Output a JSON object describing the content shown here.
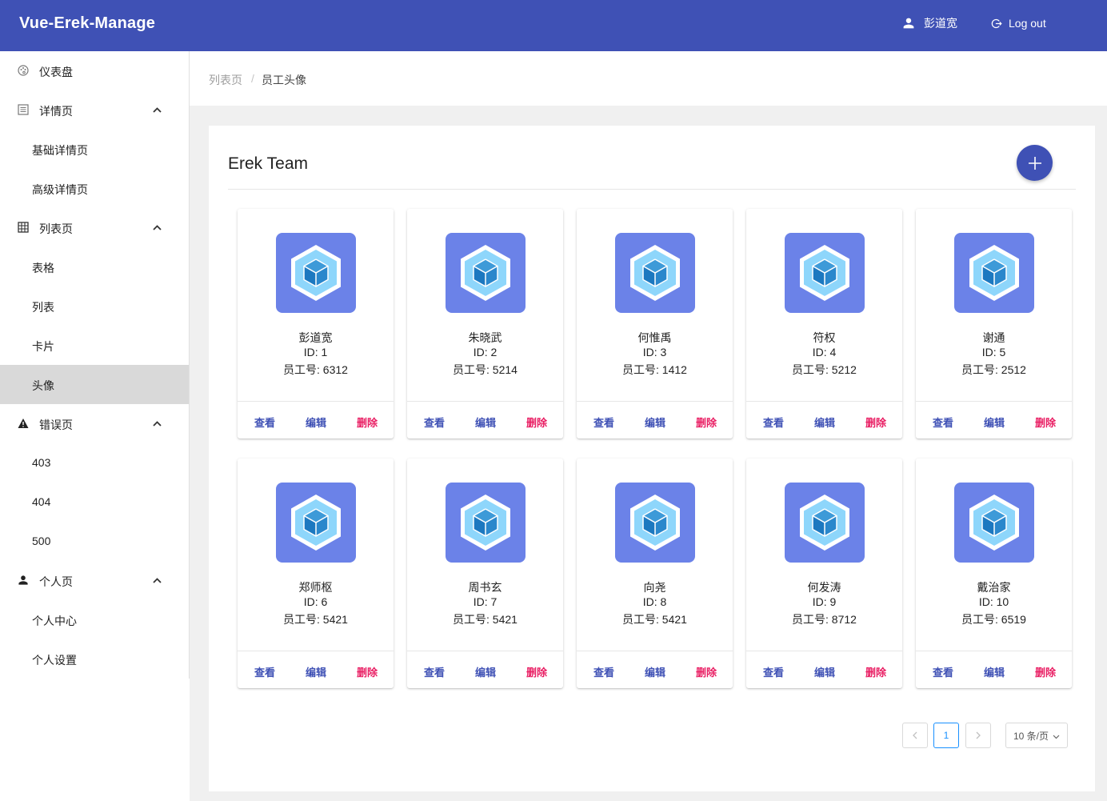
{
  "header": {
    "brand": "Vue-Erek-Manage",
    "user_name": "彭道宽",
    "logout_label": "Log out"
  },
  "sidebar": {
    "items": [
      {
        "label": "仪表盘",
        "icon": "palette-icon",
        "level": 1
      },
      {
        "label": "详情页",
        "icon": "list-alt-icon",
        "level": 1,
        "expanded": true
      },
      {
        "label": "基础详情页",
        "level": 2
      },
      {
        "label": "高级详情页",
        "level": 2
      },
      {
        "label": "列表页",
        "icon": "grid-icon",
        "level": 1,
        "expanded": true
      },
      {
        "label": "表格",
        "level": 2
      },
      {
        "label": "列表",
        "level": 2
      },
      {
        "label": "卡片",
        "level": 2
      },
      {
        "label": "头像",
        "level": 2,
        "active": true
      },
      {
        "label": "错误页",
        "icon": "warning-icon",
        "level": 1,
        "expanded": true
      },
      {
        "label": "403",
        "level": 2
      },
      {
        "label": "404",
        "level": 2
      },
      {
        "label": "500",
        "level": 2
      },
      {
        "label": "个人页",
        "icon": "person-icon",
        "level": 1,
        "expanded": true
      },
      {
        "label": "个人中心",
        "level": 2
      },
      {
        "label": "个人设置",
        "level": 2
      }
    ]
  },
  "breadcrumb": {
    "parent": "列表页",
    "separator": "/",
    "current": "员工头像"
  },
  "panel": {
    "title": "Erek Team",
    "add_button_icon": "plus-icon"
  },
  "cards": [
    {
      "name": "彭道宽",
      "id": "ID: 1",
      "employee_no": "员工号: 6312",
      "view": "查看",
      "edit": "编辑",
      "delete": "删除"
    },
    {
      "name": "朱晓武",
      "id": "ID: 2",
      "employee_no": "员工号: 5214",
      "view": "查看",
      "edit": "编辑",
      "delete": "删除"
    },
    {
      "name": "何惟禹",
      "id": "ID: 3",
      "employee_no": "员工号: 1412",
      "view": "查看",
      "edit": "编辑",
      "delete": "删除"
    },
    {
      "name": "符权",
      "id": "ID: 4",
      "employee_no": "员工号: 5212",
      "view": "查看",
      "edit": "编辑",
      "delete": "删除"
    },
    {
      "name": "谢通",
      "id": "ID: 5",
      "employee_no": "员工号: 2512",
      "view": "查看",
      "edit": "编辑",
      "delete": "删除"
    },
    {
      "name": "郑师枢",
      "id": "ID: 6",
      "employee_no": "员工号: 5421",
      "view": "查看",
      "edit": "编辑",
      "delete": "删除"
    },
    {
      "name": "周书玄",
      "id": "ID: 7",
      "employee_no": "员工号: 5421",
      "view": "查看",
      "edit": "编辑",
      "delete": "删除"
    },
    {
      "name": "向尧",
      "id": "ID: 8",
      "employee_no": "员工号: 5421",
      "view": "查看",
      "edit": "编辑",
      "delete": "删除"
    },
    {
      "name": "何发涛",
      "id": "ID: 9",
      "employee_no": "员工号: 8712",
      "view": "查看",
      "edit": "编辑",
      "delete": "删除"
    },
    {
      "name": "戴治家",
      "id": "ID: 10",
      "employee_no": "员工号: 6519",
      "view": "查看",
      "edit": "编辑",
      "delete": "删除"
    }
  ],
  "pagination": {
    "prev_icon": "chevron-left-icon",
    "current_page": "1",
    "next_icon": "chevron-right-icon",
    "page_size": "10 条/页"
  },
  "colors": {
    "primary": "#3f51b5",
    "danger": "#e91e63",
    "avatar_bg": "#6b82e8",
    "active_nav_bg": "#d9d9d9",
    "page_current": "#1890ff"
  }
}
